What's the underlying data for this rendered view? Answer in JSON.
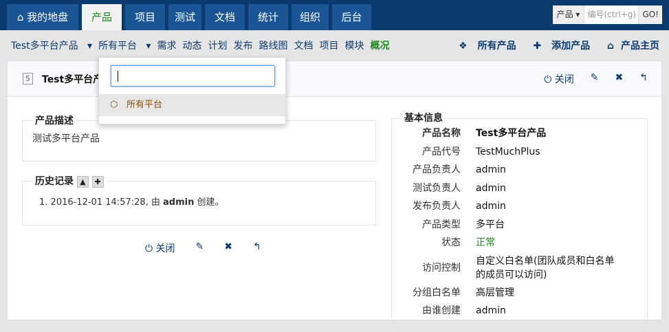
{
  "nav": {
    "tabs": [
      {
        "label": "我的地盘",
        "icon": "home-icon"
      },
      {
        "label": "产品"
      },
      {
        "label": "项目"
      },
      {
        "label": "测试"
      },
      {
        "label": "文档"
      },
      {
        "label": "统计"
      },
      {
        "label": "组织"
      },
      {
        "label": "后台"
      }
    ],
    "active": "产品"
  },
  "search": {
    "type": "产品",
    "placeholder": "编号(ctrl+g)",
    "go": "GO!"
  },
  "subnav": {
    "product": "Test多平台产品",
    "platform": "所有平台",
    "items": [
      "需求",
      "动态",
      "计划",
      "发布",
      "路线图",
      "文档",
      "项目",
      "模块"
    ],
    "active": "概况",
    "right": [
      "所有产品",
      "添加产品",
      "产品主页"
    ]
  },
  "dropdown": {
    "input": "",
    "item": "所有平台"
  },
  "header": {
    "id": "5",
    "title": "Test多平台产品",
    "close": "关闭"
  },
  "desc": {
    "legend": "产品描述",
    "text": "测试多平台产品"
  },
  "history": {
    "legend": "历史记录",
    "entry_num": "1.",
    "entry_time": "2016-12-01 14:57:28, 由 ",
    "entry_user": "admin",
    "entry_action": " 创建。"
  },
  "footer": {
    "close": "关闭"
  },
  "basic": {
    "legend": "基本信息",
    "rows": [
      {
        "k": "产品名称",
        "v": "Test多平台产品"
      },
      {
        "k": "产品代号",
        "v": "TestMuchPlus"
      },
      {
        "k": "产品负责人",
        "v": "admin"
      },
      {
        "k": "测试负责人",
        "v": "admin"
      },
      {
        "k": "发布负责人",
        "v": "admin"
      },
      {
        "k": "产品类型",
        "v": "多平台"
      },
      {
        "k": "状态",
        "v": "正常"
      },
      {
        "k": "访问控制",
        "v": "自定义白名单(团队成员和白名单的成员可以访问)"
      },
      {
        "k": "分组白名单",
        "v": "高层管理"
      },
      {
        "k": "由谁创建",
        "v": "admin"
      }
    ]
  },
  "colors": {
    "topbar": "#0b3a6e",
    "active": "#1a8a1a"
  }
}
